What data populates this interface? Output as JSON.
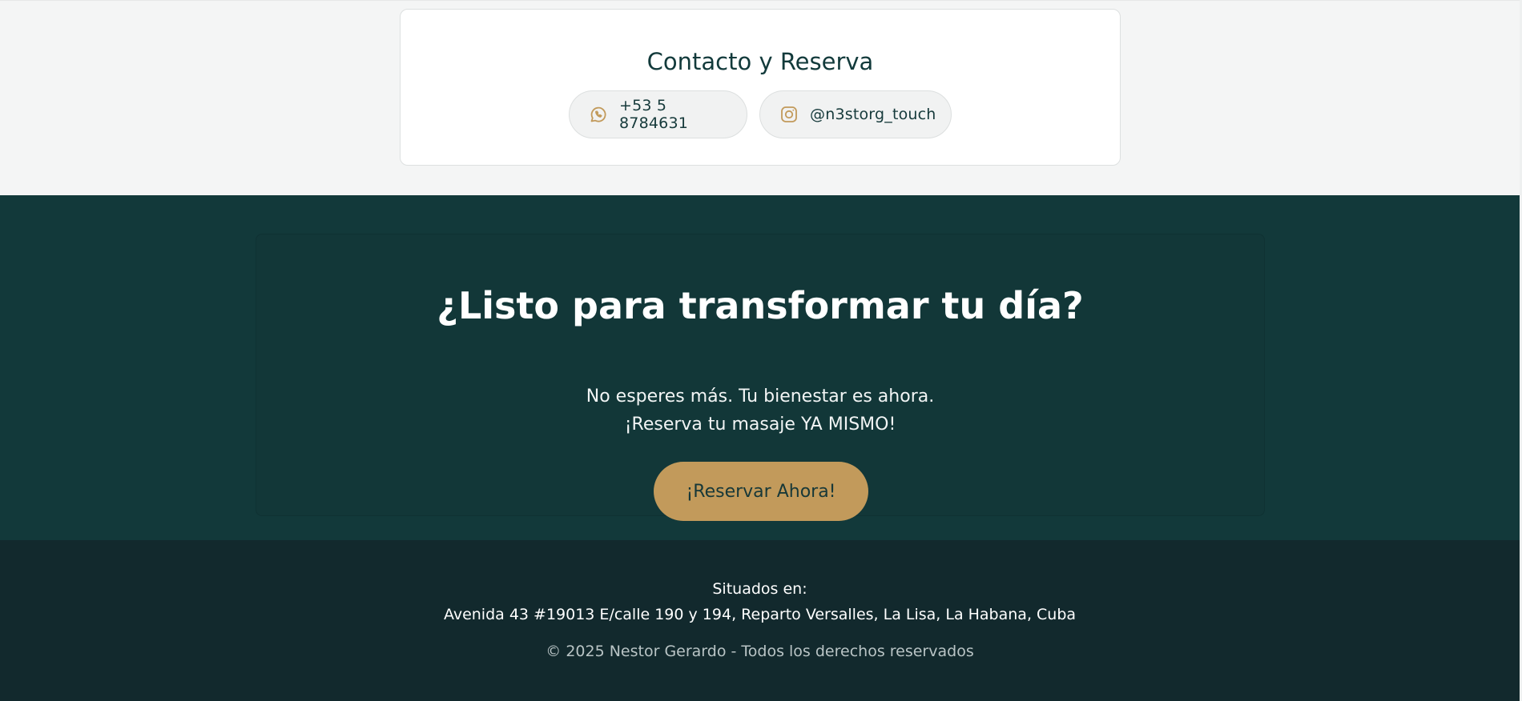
{
  "contact": {
    "title": "Contacto y Reserva",
    "phone_label": "+53 5 8784631",
    "instagram_label": "@n3storg_touch"
  },
  "cta": {
    "title": "¿Listo para transformar tu día?",
    "line1": "No esperes más. Tu bienestar es ahora.",
    "line2": "¡Reserva tu masaje YA MISMO!",
    "button_label": "¡Reservar Ahora!"
  },
  "footer": {
    "location_label": "Situados en:",
    "address": "Avenida 43 #19013 E/calle 190 y 194, Reparto Versalles, La Lisa, La Habana, Cuba",
    "copyright": "© 2025 Nestor Gerardo - Todos los derechos reservados"
  },
  "icons": {
    "phone": "whatsapp-icon",
    "instagram": "instagram-icon"
  },
  "colors": {
    "accent_gold": "#c29a5b",
    "dark_teal": "#12393a",
    "footer_bg": "#12292d",
    "light_bg": "#f4f5f5"
  }
}
